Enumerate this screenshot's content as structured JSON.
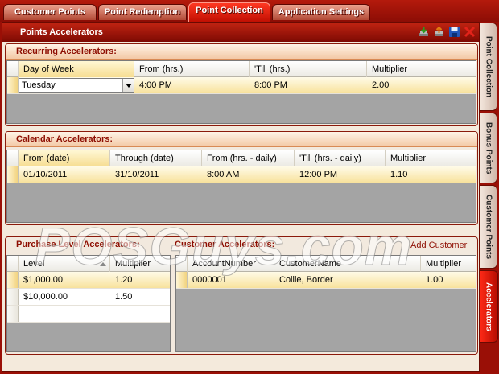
{
  "tabs": [
    {
      "label": "Customer Points",
      "active": false
    },
    {
      "label": "Point Redemption",
      "active": false
    },
    {
      "label": "Point Collection",
      "active": true
    },
    {
      "label": "Application Settings",
      "active": false
    }
  ],
  "panel": {
    "title": "Points Accelerators",
    "toolbar_icons": [
      "import-icon",
      "export-icon",
      "save-icon",
      "delete-icon"
    ]
  },
  "recurring": {
    "title": "Recurring Accelerators:",
    "columns": [
      "Day of Week",
      "From (hrs.)",
      "'Till (hrs.)",
      "Multiplier"
    ],
    "rows": [
      {
        "day": "Tuesday",
        "from": "4:00 PM",
        "till": "8:00 PM",
        "multiplier": "2.00"
      }
    ]
  },
  "calendar": {
    "title": "Calendar Accelerators:",
    "columns": [
      "From (date)",
      "Through (date)",
      "From (hrs. - daily)",
      "'Till (hrs. - daily)",
      "Multiplier"
    ],
    "rows": [
      {
        "from_date": "01/10/2011",
        "through_date": "31/10/2011",
        "from_hrs": "8:00 AM",
        "till_hrs": "12:00 PM",
        "multiplier": "1.10"
      }
    ]
  },
  "purchase": {
    "title": "Purchase Level Accelerators:",
    "columns": [
      "Level",
      "Multiplier"
    ],
    "rows": [
      {
        "level": "$1,000.00",
        "multiplier": "1.20"
      },
      {
        "level": "$10,000.00",
        "multiplier": "1.50"
      }
    ]
  },
  "customer": {
    "title": "Customer Accelerators:",
    "add_link": "Add Customer",
    "columns": [
      "AccountNumber",
      "CustomerName",
      "Multiplier"
    ],
    "rows": [
      {
        "account": "0000001",
        "name": "Collie, Border",
        "multiplier": "1.00"
      }
    ]
  },
  "side_tabs": [
    {
      "label": "Point Collection",
      "active": false
    },
    {
      "label": "Bonus Points",
      "active": false
    },
    {
      "label": "Customer Points",
      "active": false
    },
    {
      "label": "Accelerators",
      "active": true
    }
  ],
  "watermark": "POSGuys.com",
  "colors": {
    "accent": "#c1140a",
    "selected_row": "#f8e29c",
    "grid_empty": "#a4a4a4"
  }
}
